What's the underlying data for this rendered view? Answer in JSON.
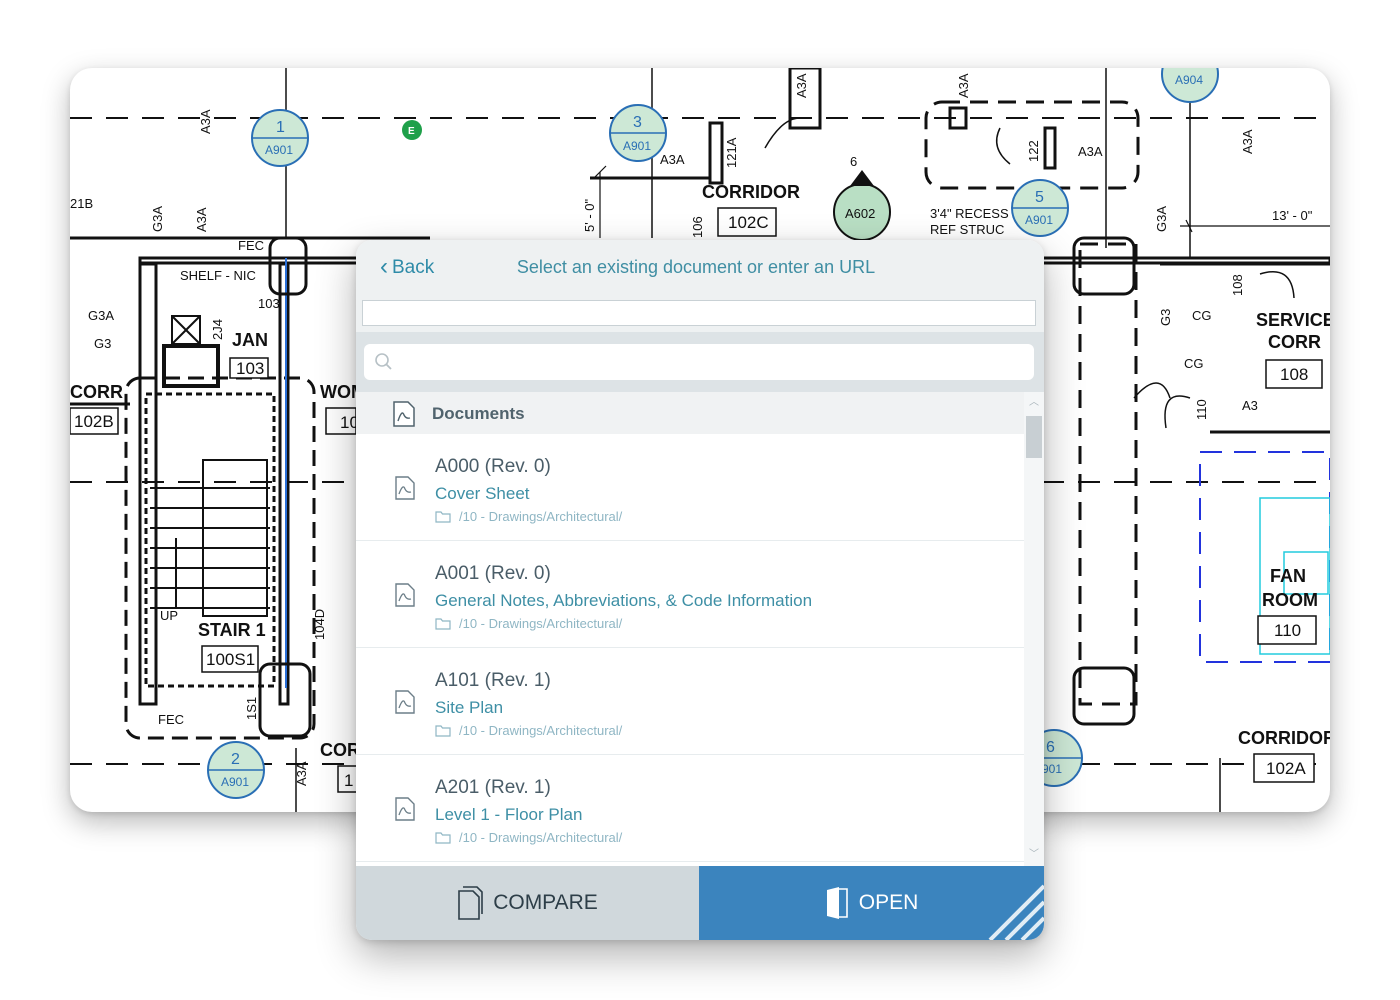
{
  "drawing": {
    "labels": [
      "A3A",
      "A3A",
      "A3A",
      "A3A",
      "A3A",
      "A3A",
      "A3A",
      "A3A",
      "G3A",
      "G3A",
      "G3A",
      "G3",
      "G3",
      "CG",
      "CG",
      "A3",
      "FEC",
      "FEC",
      "1S1",
      "104D",
      "121A",
      "122",
      "106",
      "108",
      "110",
      "5' - 0\"",
      "13' - 0\"",
      "3'4\" RECESS",
      "REF STRUC",
      "SHELF - NIC",
      "2J4",
      "21B",
      "103",
      "UP",
      "6"
    ],
    "rooms": [
      {
        "name": "CORRIDOR",
        "number": "102C"
      },
      {
        "name": "JAN",
        "number": "103"
      },
      {
        "name": "CORR",
        "number": "102B"
      },
      {
        "name": "STAIR 1",
        "number": "100S1"
      },
      {
        "name": "SERVICE",
        "name2": "CORR",
        "number": "108"
      },
      {
        "name": "FAN",
        "name2": "ROOM",
        "number": "110"
      },
      {
        "name": "CORRIDOR",
        "number": "102A"
      },
      {
        "name": "WOM",
        "number": "10"
      },
      {
        "name": "COR",
        "number": "1"
      }
    ],
    "callouts": [
      {
        "num": "1",
        "sheet": "A901"
      },
      {
        "num": "3",
        "sheet": "A901"
      },
      {
        "num": "5",
        "sheet": "A901"
      },
      {
        "num": "2",
        "sheet": "A901"
      },
      {
        "num": "6",
        "sheet": "901"
      },
      {
        "num": "",
        "sheet": "A904"
      },
      {
        "num": "",
        "sheet": "A602"
      }
    ],
    "marker": "E"
  },
  "modal": {
    "back_label": "Back",
    "title": "Select an existing document or enter an URL",
    "url_value": "",
    "search_placeholder": "",
    "section_label": "Documents",
    "documents": [
      {
        "name": "A000 (Rev. 0)",
        "description": "Cover Sheet",
        "path": "/10 - Drawings/Architectural/"
      },
      {
        "name": "A001 (Rev. 0)",
        "description": "General Notes, Abbreviations, & Code Information",
        "path": "/10 - Drawings/Architectural/"
      },
      {
        "name": "A101 (Rev. 1)",
        "description": "Site Plan",
        "path": "/10 - Drawings/Architectural/"
      },
      {
        "name": "A201 (Rev. 1)",
        "description": "Level 1 - Floor Plan",
        "path": "/10 - Drawings/Architectural/"
      }
    ],
    "compare_label": "COMPARE",
    "open_label": "OPEN"
  },
  "colors": {
    "accent": "#3b84be",
    "callout_fill": "#cde8d6",
    "callout_stroke": "#2a6fb5",
    "marker_green": "#1fa04a"
  }
}
